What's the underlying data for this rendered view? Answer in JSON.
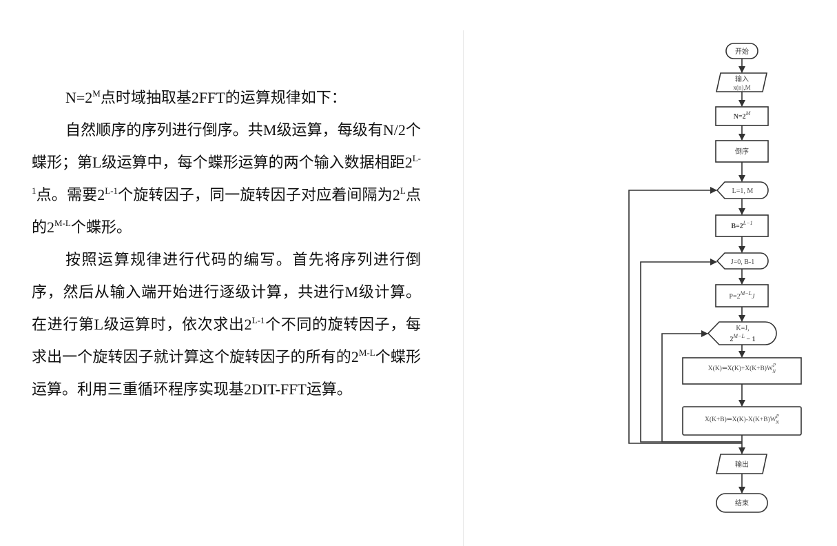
{
  "paragraphs": [
    [
      {
        "t": "N=2"
      },
      {
        "t": "M",
        "sup": true
      },
      {
        "t": "点时域抽取基2FFT的运算规律如下："
      }
    ],
    [
      {
        "t": "自然顺序的序列进行倒序。共M级运算，每级有N/2个蝶形；第L级运算中，每个蝶形运算的两个输入数据相距2"
      },
      {
        "t": "L-1",
        "sup": true
      },
      {
        "t": "点。需要2"
      },
      {
        "t": "L-1",
        "sup": true
      },
      {
        "t": "个旋转因子，同一旋转因子对应着间隔为2"
      },
      {
        "t": "L",
        "sup": true
      },
      {
        "t": "点的2"
      },
      {
        "t": "M-L",
        "sup": true
      },
      {
        "t": "个蝶形。"
      }
    ],
    [
      {
        "t": "按照运算规律进行代码的编写。首先将序列进行倒序，然后从输入端开始进行逐级计算，共进行M级计算。在进行第L级运算时，依次求出2"
      },
      {
        "t": "L-1",
        "sup": true
      },
      {
        "t": "个不同的旋转因子，每求出一个旋转因子就计算这个旋转因子的所有的2"
      },
      {
        "t": "M-L",
        "sup": true
      },
      {
        "t": "个蝶形运算。利用三重循环程序实现基2DIT-FFT运算。"
      }
    ]
  ],
  "flowchart": {
    "start": "开始",
    "input_line1": "输入",
    "input_line2": "x(n),M",
    "n_base": "N=2",
    "n_exp": "M",
    "reverse": "倒序",
    "loop_l": "L=1, M",
    "b_base": "B=2",
    "b_exp": "L−1",
    "loop_j": "J=0, B-1",
    "p_base": "P=2",
    "p_exp": "M−L",
    "p_tail": "J",
    "loop_k_line1": "K=J,",
    "loop_k_base": "2",
    "loop_k_exp": "M−L",
    "loop_k_tail": " − 1",
    "step1_main": "X(K)⇐X(K)+X(K+B)W",
    "step1_sup": "P",
    "step1_sub": "N",
    "step2_main": "X(K+B)⇐X(K)-X(K+B)W",
    "step2_sup": "P",
    "step2_sub": "N",
    "output": "输出",
    "end": "结束"
  }
}
